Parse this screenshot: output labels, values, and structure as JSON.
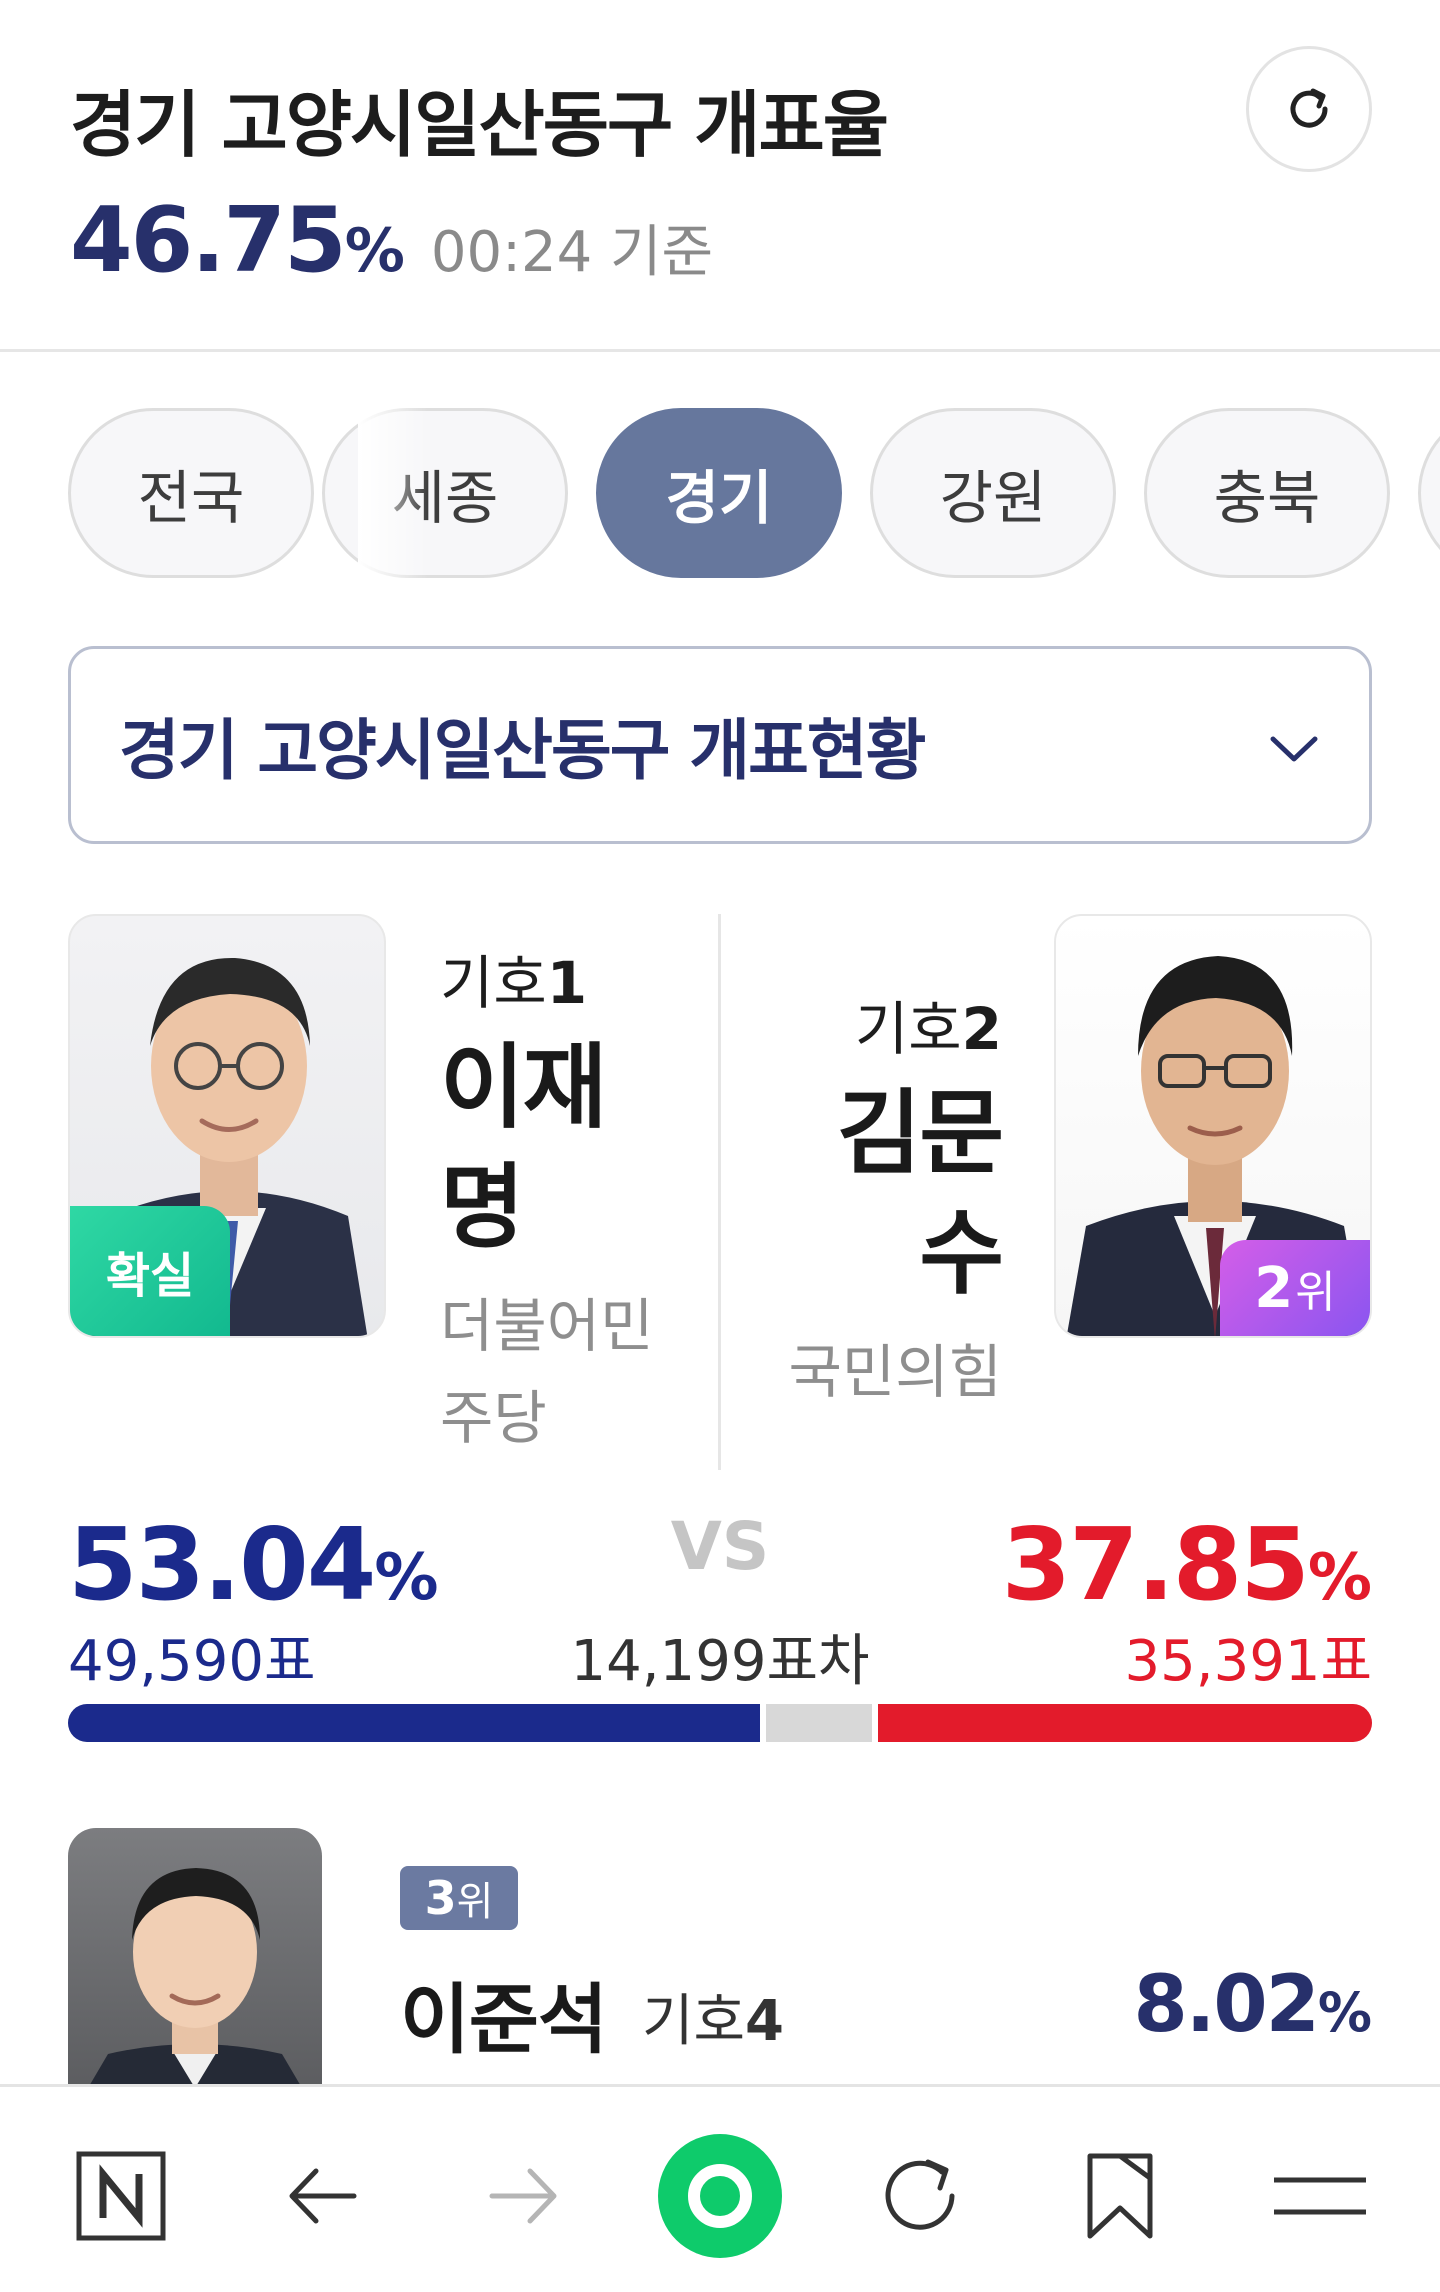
{
  "header": {
    "title": "경기 고양시일산동구 개표율",
    "rate_value": "46.75",
    "rate_unit": "%",
    "rate_time": "00:24 기준"
  },
  "tabs": [
    {
      "label": "전국",
      "active": false
    },
    {
      "label": "세종",
      "active": false
    },
    {
      "label": "경기",
      "active": true
    },
    {
      "label": "강원",
      "active": false
    },
    {
      "label": "충북",
      "active": false
    }
  ],
  "dropdown": {
    "selected": "경기 고양시일산동구 개표현황"
  },
  "candidates": [
    {
      "number_label": "기호",
      "number": "1",
      "name_line1": "이재",
      "name_line2": "명",
      "party_line1": "더불어민",
      "party_line2": "주당",
      "badge": "확실",
      "percent": "53.04",
      "percent_unit": "%",
      "votes": "49,590표",
      "color": "#1b2a8c",
      "share": 53.04
    },
    {
      "number_label": "기호",
      "number": "2",
      "name_line1": "김문",
      "name_line2": "수",
      "party_line1": "국민의힘",
      "badge_rank": "2",
      "badge_suffix": "위",
      "percent": "37.85",
      "percent_unit": "%",
      "votes": "35,391표",
      "color": "#e31b2b",
      "share": 37.85
    }
  ],
  "comparison": {
    "vs_label": "VS",
    "difference": "14,199표차"
  },
  "third_candidate": {
    "rank": "3",
    "rank_suffix": "위",
    "name": "이준석",
    "number_label": "기호",
    "number": "4",
    "percent": "8.02",
    "percent_unit": "%"
  },
  "colors": {
    "accent_navy": "#27306b",
    "blue_party": "#1b2a8c",
    "red_party": "#e31b2b",
    "tab_active": "#66779d",
    "confirm_badge": "#1fc897",
    "rank2_badge": "#b05aed",
    "nav_green": "#0ecb6b"
  },
  "bottom_nav": [
    {
      "icon": "naver-n-icon"
    },
    {
      "icon": "arrow-left-icon"
    },
    {
      "icon": "arrow-right-icon"
    },
    {
      "icon": "green-dot-icon"
    },
    {
      "icon": "reload-icon"
    },
    {
      "icon": "bookmark-icon"
    },
    {
      "icon": "menu-icon"
    }
  ]
}
